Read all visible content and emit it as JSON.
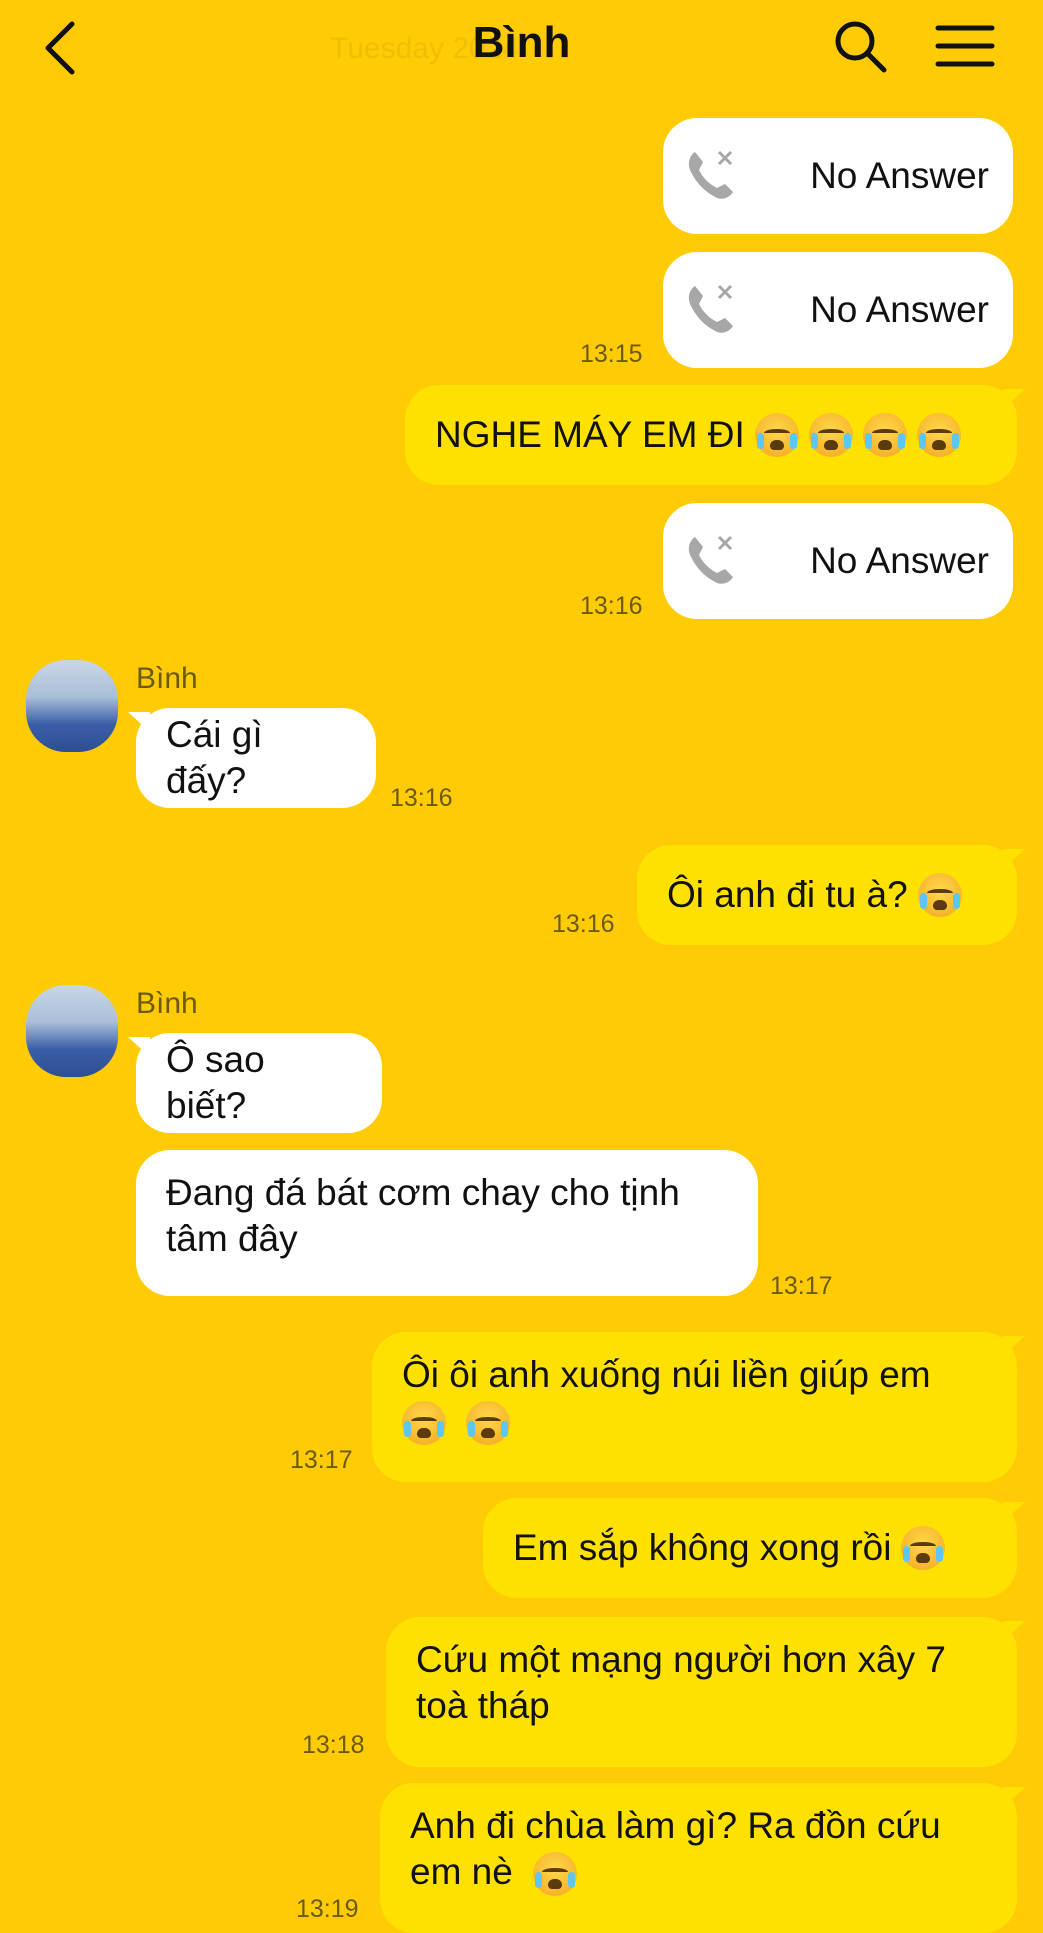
{
  "header": {
    "title": "Bình",
    "ghost_date": "Tuesday 2024"
  },
  "messages": [
    {
      "type": "call",
      "text": "No Answer"
    },
    {
      "type": "call",
      "text": "No Answer",
      "time": "13:15"
    },
    {
      "type": "out",
      "text": "NGHE MÁY EM ĐI",
      "emoji": 4
    },
    {
      "type": "call",
      "text": "No Answer",
      "time": "13:16"
    },
    {
      "type": "in",
      "sender": "Bình",
      "text": "Cái gì đấy?",
      "time": "13:16"
    },
    {
      "type": "out",
      "text": "Ôi anh đi tu à?",
      "emoji": 1,
      "time": "13:16"
    },
    {
      "type": "in",
      "sender": "Bình",
      "text": "Ô sao biết?"
    },
    {
      "type": "in",
      "lines": [
        "Đang đá bát cơm chay cho tịnh",
        "tâm đây"
      ],
      "time": "13:17"
    },
    {
      "type": "out",
      "lines": [
        "Ôi ôi anh xuống núi liền giúp em",
        ""
      ],
      "emoji": 2,
      "time": "13:17"
    },
    {
      "type": "out",
      "text": "Em sắp không xong rồi",
      "emoji": 1
    },
    {
      "type": "out",
      "lines": [
        "Cứu một mạng người hơn xây 7",
        "toà tháp"
      ],
      "time": "13:18"
    },
    {
      "type": "out",
      "lines": [
        "Anh đi chùa làm gì? Ra đồn cứu",
        "em nè"
      ],
      "emoji": 1,
      "time": "13:19"
    }
  ],
  "icons": [
    "back-arrow-icon",
    "search-icon",
    "menu-icon",
    "missed-call-icon",
    "crying-emoji-icon"
  ],
  "colors": {
    "background": "#FFCB05",
    "outgoing_bubble": "#FFE100",
    "incoming_bubble": "#FFFFFF",
    "timestamp": "#6b5a10"
  }
}
